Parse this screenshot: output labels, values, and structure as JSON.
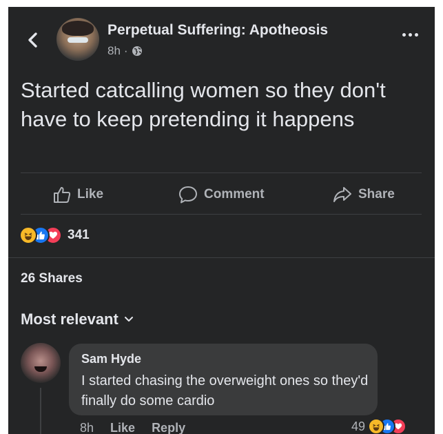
{
  "post": {
    "author": "Perpetual Suffering: Apotheosis",
    "time": "8h",
    "separator": "·",
    "text": "Started catcalling women so they don't have to keep pretending it happens"
  },
  "actions": {
    "like": "Like",
    "comment": "Comment",
    "share": "Share"
  },
  "reactions": {
    "count": "341",
    "types": [
      "haha",
      "like",
      "love"
    ]
  },
  "shares": "26 Shares",
  "sort": {
    "label": "Most relevant"
  },
  "comment": {
    "author": "Sam Hyde",
    "text": "I started chasing the overweight ones so they'd finally do some cardio",
    "time": "8h",
    "like": "Like",
    "reply": "Reply",
    "reaction_count": "49"
  },
  "colors": {
    "background": "#242526",
    "bubble": "#3a3b3c",
    "text": "#e4e6eb",
    "secondary": "#b0b3b8",
    "like_blue": "#1877f2",
    "love_red": "#f33e58",
    "haha_yellow": "#f7b928"
  },
  "icons": {
    "back": "chevron-left-icon",
    "globe": "globe-icon",
    "more": "more-horizontal-icon",
    "like": "thumbs-up-icon",
    "comment": "comment-bubble-icon",
    "share": "share-arrow-icon",
    "dropdown": "chevron-down-icon"
  }
}
